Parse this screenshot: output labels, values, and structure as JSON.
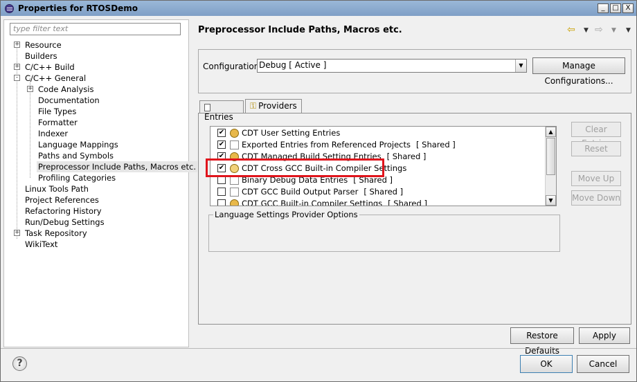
{
  "window": {
    "title": "Properties for RTOSDemo",
    "controls": [
      "_",
      "□",
      "X"
    ]
  },
  "sidebar": {
    "filter_placeholder": "type filter text",
    "items": [
      {
        "label": "Resource",
        "expander": "+"
      },
      {
        "label": "Builders",
        "expander": ""
      },
      {
        "label": "C/C++ Build",
        "expander": "+"
      },
      {
        "label": "C/C++ General",
        "expander": "-"
      },
      {
        "label": "Code Analysis",
        "expander": "+"
      },
      {
        "label": "Documentation",
        "expander": ""
      },
      {
        "label": "File Types",
        "expander": ""
      },
      {
        "label": "Formatter",
        "expander": ""
      },
      {
        "label": "Indexer",
        "expander": ""
      },
      {
        "label": "Language Mappings",
        "expander": ""
      },
      {
        "label": "Paths and Symbols",
        "expander": ""
      },
      {
        "label": "Preprocessor Include Paths, Macros etc.",
        "expander": "",
        "selected": true
      },
      {
        "label": "Profiling Categories",
        "expander": ""
      },
      {
        "label": "Linux Tools Path",
        "expander": ""
      },
      {
        "label": "Project References",
        "expander": ""
      },
      {
        "label": "Refactoring History",
        "expander": ""
      },
      {
        "label": "Run/Debug Settings",
        "expander": ""
      },
      {
        "label": "Task Repository",
        "expander": "+"
      },
      {
        "label": "WikiText",
        "expander": ""
      }
    ]
  },
  "main": {
    "page_title": "Preprocessor Include Paths, Macros etc.",
    "configuration": {
      "label": "Configuration:",
      "value": "Debug  [ Active ]",
      "manage_button": "Manage Configurations..."
    },
    "tabs": [
      {
        "label": "Entries",
        "active": false
      },
      {
        "label": "Providers",
        "active": true
      }
    ],
    "providers": [
      {
        "label": "CDT User Setting Entries",
        "shared": "",
        "checked": true,
        "icon": "user-settings-icon"
      },
      {
        "label": "Exported Entries from Referenced Projects",
        "shared": "[ Shared ]",
        "checked": true,
        "icon": "referenced-projects-icon"
      },
      {
        "label": "CDT Managed Build Setting Entries",
        "shared": "[ Shared ]",
        "checked": true,
        "icon": "managed-build-icon"
      },
      {
        "label": "CDT Cross GCC Built-in Compiler Settings",
        "shared": "",
        "checked": true,
        "icon": "compiler-settings-icon"
      },
      {
        "label": "Binary Debug Data Entries",
        "shared": "[ Shared ]",
        "checked": false,
        "icon": "binary-debug-icon"
      },
      {
        "label": "CDT GCC Build Output Parser",
        "shared": "[ Shared ]",
        "checked": false,
        "icon": "build-output-icon"
      },
      {
        "label": "CDT GCC Built-in Compiler Settings",
        "shared": "[ Shared ]",
        "checked": false,
        "icon": "gcc-compiler-icon"
      }
    ],
    "side_buttons": {
      "clear_entries": "Clear Entries",
      "reset": "Reset",
      "move_up": "Move Up",
      "move_down": "Move Down"
    },
    "options_group_label": "Language Settings Provider Options",
    "restore_defaults": "Restore Defaults",
    "apply": "Apply"
  },
  "footer": {
    "help": "?",
    "ok": "OK",
    "cancel": "Cancel"
  }
}
